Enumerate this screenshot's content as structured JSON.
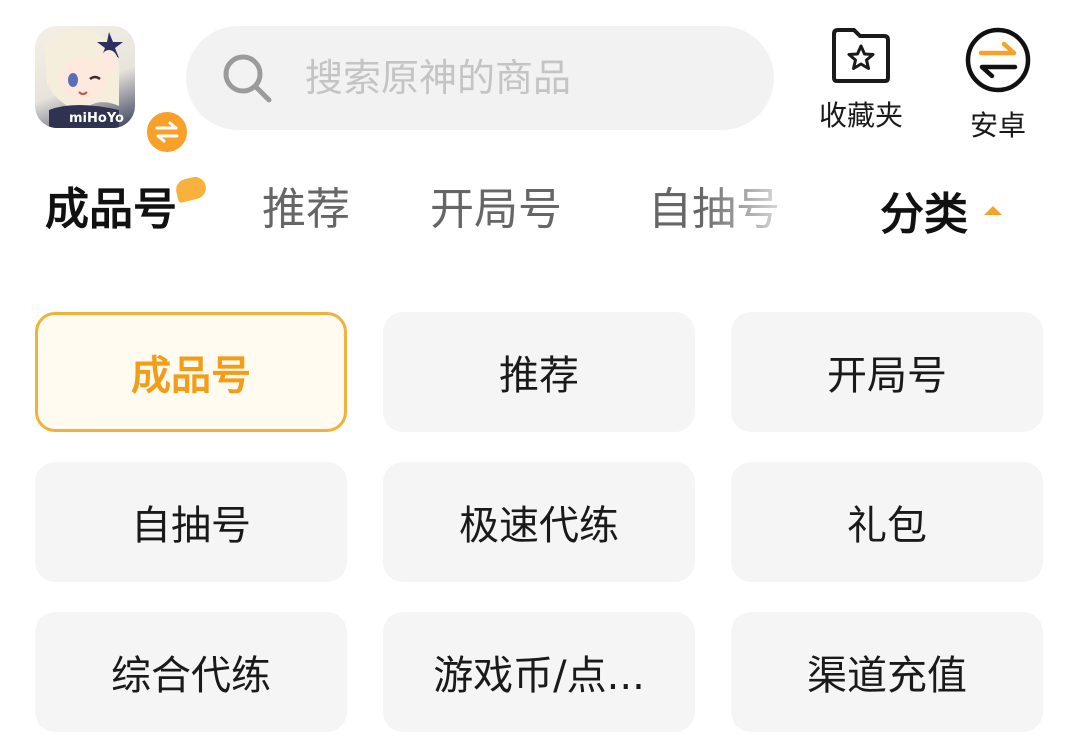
{
  "app": {
    "icon_name": "genshin-app-icon",
    "logo_text": "miHoYo",
    "swap_icon": "swap-arrows-icon"
  },
  "search": {
    "placeholder": "搜索原神的商品",
    "value": ""
  },
  "header_actions": [
    {
      "label": "收藏夹",
      "icon": "star-folder-icon"
    },
    {
      "label": "安卓",
      "icon": "swap-circle-icon"
    }
  ],
  "tabs": [
    {
      "label": "成品号",
      "active": true
    },
    {
      "label": "推荐",
      "active": false
    },
    {
      "label": "开局号",
      "active": false
    },
    {
      "label": "自抽号",
      "active": false
    }
  ],
  "category_toggle": {
    "label": "分类",
    "icon": "caret-up-icon"
  },
  "categories": [
    {
      "label": "成品号",
      "active": true
    },
    {
      "label": "推荐",
      "active": false
    },
    {
      "label": "开局号",
      "active": false
    },
    {
      "label": "自抽号",
      "active": false
    },
    {
      "label": "极速代练",
      "active": false
    },
    {
      "label": "礼包",
      "active": false
    },
    {
      "label": "综合代练",
      "active": false
    },
    {
      "label": "游戏币/点...",
      "active": false
    },
    {
      "label": "渠道充值",
      "active": false
    }
  ],
  "colors": {
    "accent": "#f7a12a",
    "active_text": "#f29c17",
    "active_border": "#f0b23a",
    "cell_bg": "#f5f5f5",
    "search_bg": "#f2f2f2"
  }
}
